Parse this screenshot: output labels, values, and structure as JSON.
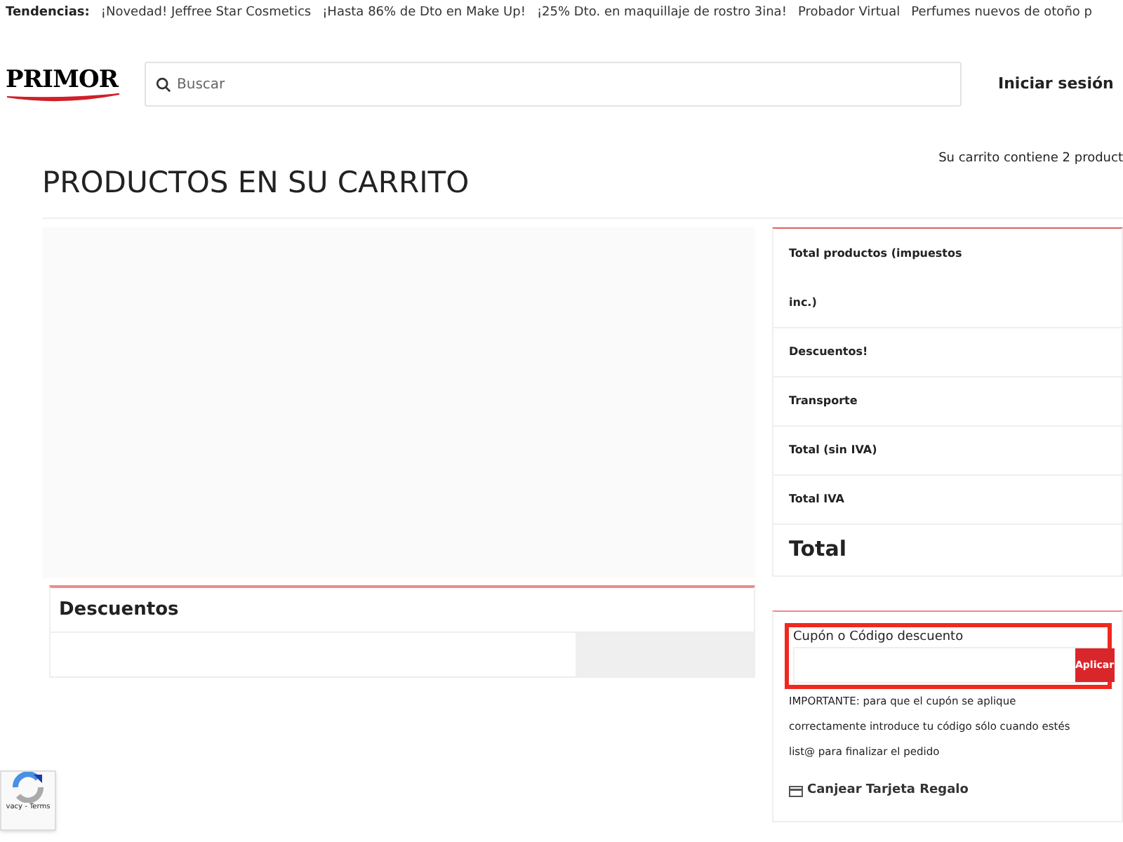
{
  "trends": {
    "label": "Tendencias:",
    "links": [
      "¡Novedad! Jeffree Star Cosmetics",
      "¡Hasta 86% de Dto en Make Up!",
      "¡25% Dto. en maquillaje de rostro 3ina!",
      "Probador Virtual",
      "Perfumes nuevos de otoño p"
    ]
  },
  "header": {
    "logo": "PRIMOR",
    "search": {
      "placeholder": "Buscar"
    },
    "login": "Iniciar sesión"
  },
  "page": {
    "title": "PRODUCTOS EN SU CARRITO",
    "cart_count": "Su carrito contiene 2 product"
  },
  "discounts": {
    "title": "Descuentos"
  },
  "summary": {
    "rows": [
      {
        "label": "Total productos (impuestos inc.)",
        "kind": "normal"
      },
      {
        "label": "Descuentos!",
        "kind": "normal"
      },
      {
        "label": "Transporte",
        "kind": "normal"
      },
      {
        "label": "Total (sin IVA)",
        "kind": "normal"
      },
      {
        "label": "Total IVA",
        "kind": "normal"
      },
      {
        "label": "Total",
        "kind": "grand"
      }
    ]
  },
  "coupon": {
    "label": "Cupón o Código descuento",
    "button": "Aplicar",
    "note": "IMPORTANTE: para que el cupón se aplique correctamente introduce tu código sólo cuando estés list@ para finalizar el pedido",
    "gift_card": "Canjear Tarjeta Regalo"
  },
  "recaptcha": {
    "text": "vacy - Terms"
  }
}
